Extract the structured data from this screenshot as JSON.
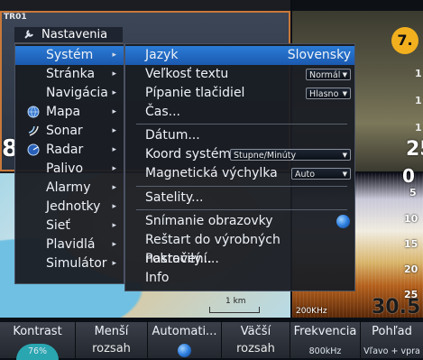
{
  "chart": {
    "header_left": "TR01",
    "scale_label": "1 km",
    "depth_big": "8"
  },
  "sonar": {
    "pane_badge": "7.",
    "top_digit_1": "1",
    "top_digit_2": "1",
    "top_digit_3": "1",
    "top_big": "25",
    "bottom_top_depth": "0",
    "ticks": [
      "5",
      "10",
      "15",
      "20",
      "25"
    ],
    "frequency_tag": "200KHz",
    "current_depth": "30.5"
  },
  "main_menu": {
    "title": "Nastavenia",
    "items": [
      {
        "label": "Systém",
        "icon": "",
        "selected": true
      },
      {
        "label": "Stránka",
        "icon": ""
      },
      {
        "label": "Navigácia",
        "icon": ""
      },
      {
        "label": "Mapa",
        "icon": "globe-icon"
      },
      {
        "label": "Sonar",
        "icon": "sonar-icon"
      },
      {
        "label": "Radar",
        "icon": "radar-icon"
      },
      {
        "label": "Palivo",
        "icon": ""
      },
      {
        "label": "Alarmy",
        "icon": ""
      },
      {
        "label": "Jednotky",
        "icon": ""
      },
      {
        "label": "Sieť",
        "icon": ""
      },
      {
        "label": "Plavidlá",
        "icon": ""
      },
      {
        "label": "Simulátor",
        "icon": ""
      }
    ]
  },
  "system_menu": {
    "language_label": "Jazyk",
    "language_value": "Slovensky",
    "text_size_label": "Veľkosť textu",
    "text_size_value": "Normál",
    "key_beep_label": "Pípanie tlačidiel",
    "key_beep_value": "Hlasno",
    "time_label": "Čas...",
    "datum_label": "Dátum...",
    "coord_label": "Koord systém",
    "coord_value": "Stupne/Minúty",
    "magvar_label": "Magnetická výchylka",
    "magvar_value": "Auto",
    "satellites_label": "Satelity...",
    "screenshot_label": "Snímanie obrazovky",
    "screenshot_on": true,
    "reset_label": "Reštart do výrobných nastavení...",
    "advanced_label": "Pokročilý...",
    "info_label": "Info"
  },
  "toolbar": {
    "contrast_label": "Kontrast",
    "contrast_value": "76%",
    "range_less_label": "Menší",
    "range_less_sub": "rozsah",
    "auto_label": "Automati...",
    "range_more_label": "Väčší",
    "range_more_sub": "rozsah",
    "frequency_label": "Frekvencia",
    "frequency_value": "800kHz",
    "view_label": "Pohľad",
    "view_value": "Vľavo + vpra"
  },
  "colors": {
    "accent_blue": "#2a7bd6",
    "badge_yellow": "#f2b01e",
    "active_border": "#c9793a"
  }
}
